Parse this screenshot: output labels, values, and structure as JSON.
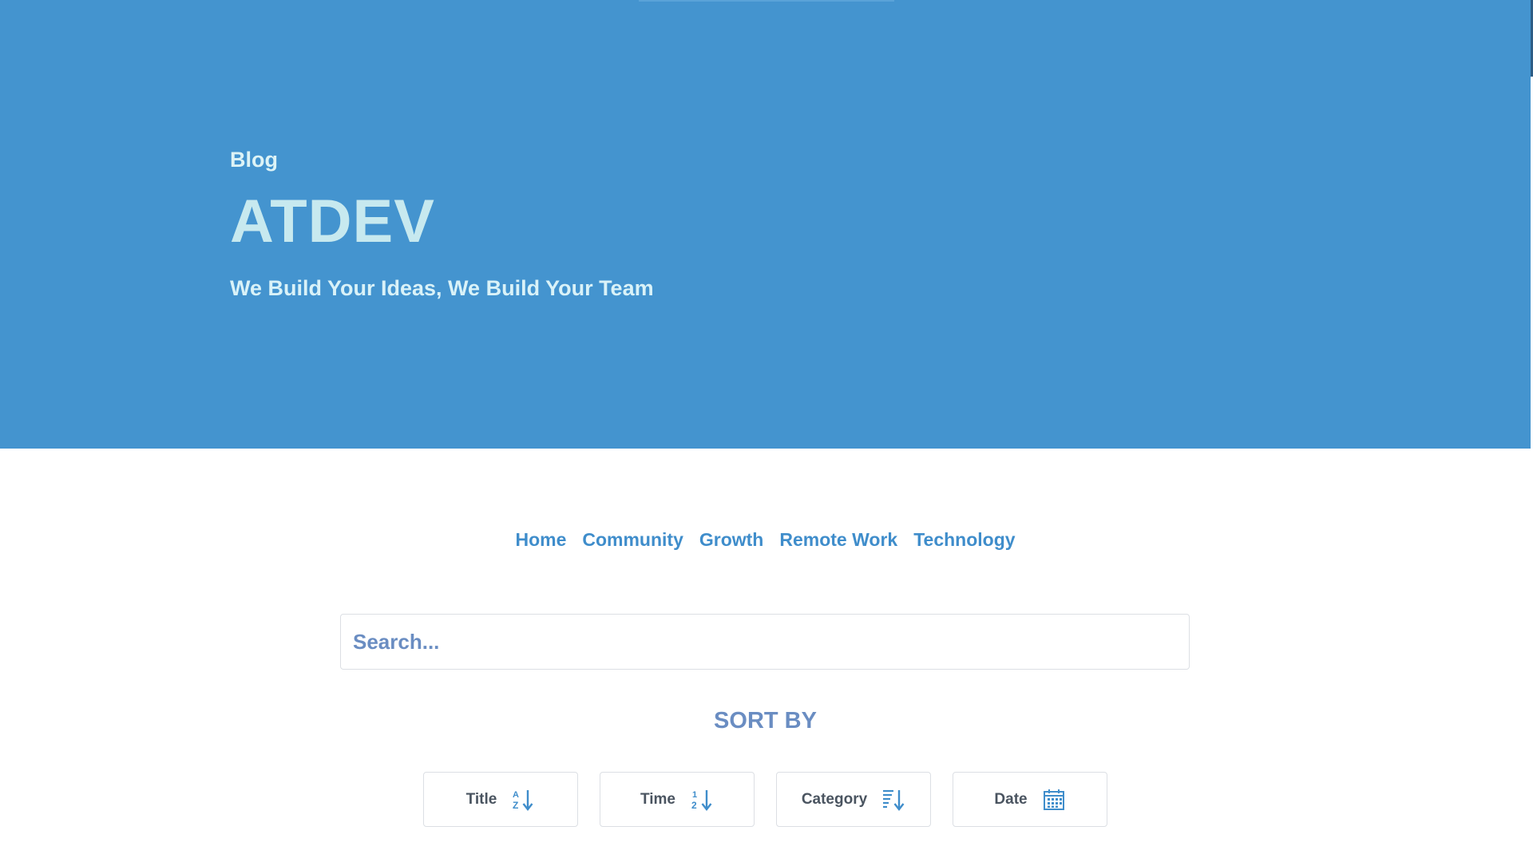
{
  "hero": {
    "label": "Blog",
    "title": "ATDEV",
    "tagline": "We Build Your Ideas, We Build Your Team",
    "background_color": "#4494cf"
  },
  "nav": {
    "items": [
      {
        "label": "Home"
      },
      {
        "label": "Community"
      },
      {
        "label": "Growth"
      },
      {
        "label": "Remote Work"
      },
      {
        "label": "Technology"
      }
    ],
    "link_color": "#3f8dcb"
  },
  "search": {
    "placeholder": "Search...",
    "value": ""
  },
  "sort": {
    "heading": "SORT BY",
    "buttons": [
      {
        "label": "Title",
        "icon": "sort-alpha-down-icon"
      },
      {
        "label": "Time",
        "icon": "sort-numeric-down-icon"
      },
      {
        "label": "Category",
        "icon": "sort-amount-down-icon"
      },
      {
        "label": "Date",
        "icon": "calendar-icon"
      }
    ],
    "icon_color": "#3f8dcb"
  }
}
